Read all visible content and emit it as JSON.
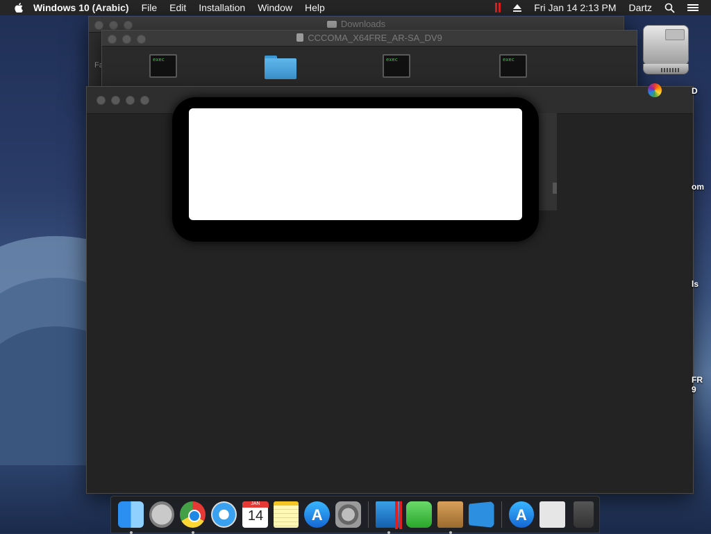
{
  "menubar": {
    "app_name": "Windows 10 (Arabic)",
    "menus": [
      "File",
      "Edit",
      "Installation",
      "Window",
      "Help"
    ],
    "clock": "Fri Jan 14  2:13 PM",
    "user": "Dartz"
  },
  "windows": {
    "downloads_title": "Downloads",
    "dvd_title": "CCCOMA_X64FRE_AR-SA_DV9",
    "side_text": "Fa"
  },
  "files": {
    "exec_label": "exec"
  },
  "desktop": {
    "labels": [
      "D",
      "om",
      "ls",
      "FR\n9"
    ]
  },
  "dock": {
    "calendar_month": "JAN",
    "calendar_day": "14"
  },
  "colors": {
    "menubar_bg": "#262626",
    "window_bg": "#232323",
    "parallels_red": "#e02020",
    "folder_blue": "#3c94cf"
  }
}
